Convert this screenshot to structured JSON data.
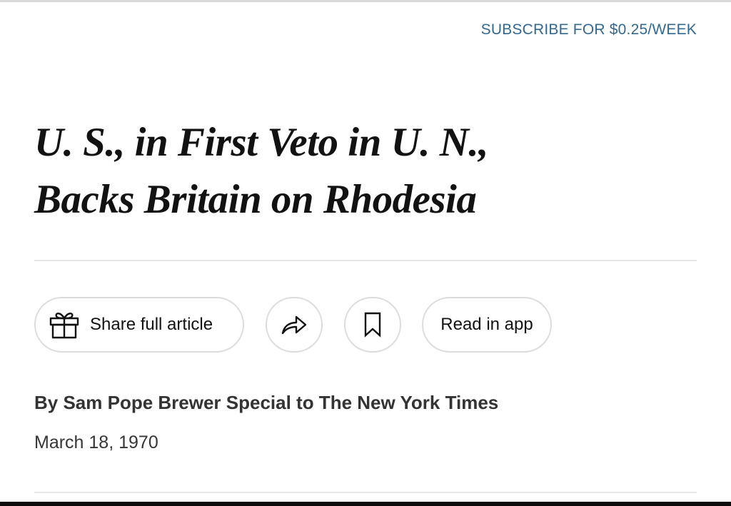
{
  "header": {
    "subscribe_label": "SUBSCRIBE FOR $0.25/WEEK"
  },
  "article": {
    "headline_line1": "U. S., in First Veto in U. N.,",
    "headline_line2": "Backs Britain on Rhodesia",
    "byline": "By Sam Pope Brewer Special to The New York Times",
    "date": "March 18, 1970"
  },
  "actions": {
    "share_label": "Share full article",
    "share_icon": "gift-icon",
    "forward_icon": "share-arrow-icon",
    "save_icon": "bookmark-icon",
    "read_in_app_label": "Read in app"
  },
  "colors": {
    "link_blue": "#326891",
    "text": "#121212",
    "border": "#dcdcdc"
  }
}
